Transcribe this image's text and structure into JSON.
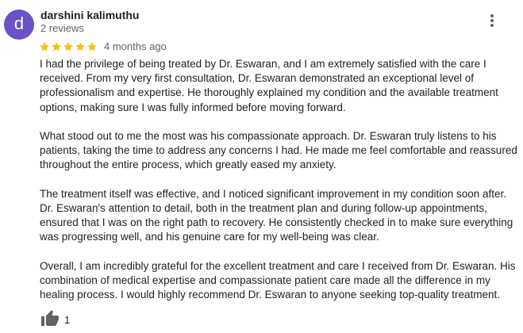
{
  "reviewer": {
    "initial": "d",
    "avatar_color": "#6b52c8",
    "name": "darshini kalimuthu",
    "review_count": "2 reviews"
  },
  "rating": {
    "stars": 5,
    "max_stars": 5,
    "star_color": "#fbbc04",
    "star_icon": "star-icon"
  },
  "date": "4 months ago",
  "menu_icon": "more-vert-icon",
  "review_paragraphs": [
    "I had the privilege of being treated by Dr. Eswaran, and I am extremely satisfied with the care I received. From my very first consultation, Dr. Eswaran demonstrated an exceptional level of professionalism and expertise. He thoroughly explained my condition and the available treatment options, making sure I was fully informed before moving forward.",
    "What stood out to me the most was his compassionate approach. Dr. Eswaran truly listens to his patients, taking the time to address any concerns I had. He made me feel comfortable and reassured throughout the entire process, which greatly eased my anxiety.",
    "The treatment itself was effective, and I noticed significant improvement in my condition soon after. Dr. Eswaran's attention to detail, both in the treatment plan and during follow-up appointments, ensured that I was on the right path to recovery. He consistently checked in to make sure everything was progressing well, and his genuine care for my well-being was clear.",
    "Overall, I am incredibly grateful for the excellent treatment and care I received from Dr. Eswaran. His combination of medical expertise and compassionate patient care made all the difference in my healing process. I would highly recommend Dr. Eswaran to anyone seeking top-quality treatment."
  ],
  "likes": {
    "icon": "thumbs-up-icon",
    "count": "1"
  }
}
